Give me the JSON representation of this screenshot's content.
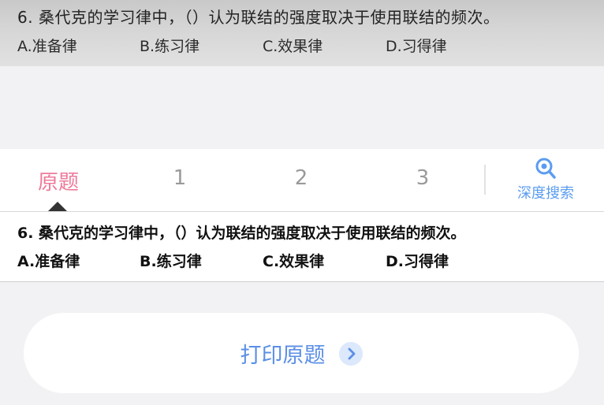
{
  "photo": {
    "question": "6. 桑代克的学习律中，（）认为联结的强度取决于使用联结的频次。",
    "options": [
      "A.准备律",
      "B.练习律",
      "C.效果律",
      "D.习得律"
    ]
  },
  "tabs": {
    "original": "原题",
    "t1": "1",
    "t2": "2",
    "t3": "3",
    "deep_search": "深度搜索",
    "active": "原题"
  },
  "panel": {
    "question": "6. 桑代克的学习律中，（）认为联结的强度取决于使用联结的频次。",
    "options": [
      "A.准备律",
      "B.练习律",
      "C.效果律",
      "D.习得律"
    ]
  },
  "print": {
    "label": "打印原题"
  },
  "colors": {
    "active_tab": "#ee7a9a",
    "accent_blue": "#5b8fe6",
    "inactive_tab": "#9a9a9a"
  }
}
